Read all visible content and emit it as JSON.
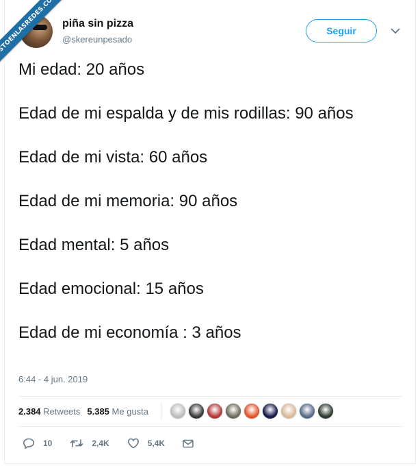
{
  "watermark": {
    "text": "VISTOENLASREDES.COM"
  },
  "user": {
    "display_name": "piña sin pizza",
    "handle": "@skereunpesado",
    "avatar_icon": "user-avatar"
  },
  "follow_label": "Seguir",
  "tweet": {
    "lines": [
      "Mi edad: 20 años",
      "Edad de mi espalda y de mis rodillas: 90 años",
      "Edad de mi vista: 60 años",
      "Edad de mi memoria: 90 años",
      "Edad mental: 5 años",
      "Edad emocional: 15 años",
      "Edad de mi economía : 3 años"
    ],
    "timestamp": "6:44 - 4 jun. 2019"
  },
  "stats": {
    "retweets_count": "2.384",
    "retweets_label": "Retweets",
    "likes_count": "5.385",
    "likes_label": "Me gusta"
  },
  "liker_colors": [
    "#bdbdbd",
    "#3a3a3a",
    "#b23a3a",
    "#6e6a5c",
    "#e0562a",
    "#1a1a4a",
    "#d8b89a",
    "#5a6a8a",
    "#2f3a2f"
  ],
  "actions": {
    "replies": "10",
    "retweets": "2,4K",
    "likes": "5,4K"
  },
  "colors": {
    "accent": "#1da1f2",
    "muted": "#657786",
    "text": "#14171a"
  }
}
